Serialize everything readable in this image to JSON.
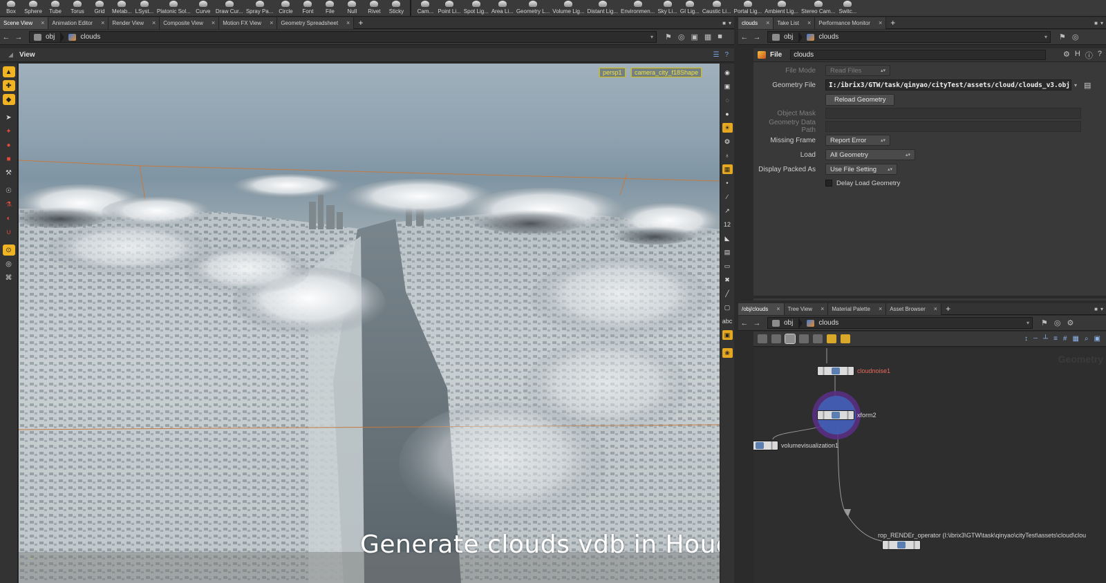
{
  "shelf": {
    "tools_left": [
      {
        "label": "Box",
        "icon": "box-icon"
      },
      {
        "label": "Sphere",
        "icon": "sphere-icon"
      },
      {
        "label": "Tube",
        "icon": "tube-icon"
      },
      {
        "label": "Torus",
        "icon": "torus-icon"
      },
      {
        "label": "Grid",
        "icon": "grid-icon"
      },
      {
        "label": "Metab...",
        "icon": "metaball-icon"
      },
      {
        "label": "LSyst...",
        "icon": "lsystem-icon"
      },
      {
        "label": "Platonic Sol...",
        "icon": "platonic-icon"
      },
      {
        "label": "Curve",
        "icon": "curve-icon"
      },
      {
        "label": "Draw Cur...",
        "icon": "draw-curve-icon"
      },
      {
        "label": "Spray Pa...",
        "icon": "spray-paint-icon"
      },
      {
        "label": "Circle",
        "icon": "circle-icon"
      },
      {
        "label": "Font",
        "icon": "font-icon"
      },
      {
        "label": "File",
        "icon": "file-icon"
      },
      {
        "label": "Null",
        "icon": "null-icon"
      },
      {
        "label": "Rivet",
        "icon": "rivet-icon"
      },
      {
        "label": "Sticky",
        "icon": "sticky-icon"
      }
    ],
    "tools_right": [
      {
        "label": "Cam...",
        "icon": "camera-icon"
      },
      {
        "label": "Point Li...",
        "icon": "point-light-icon"
      },
      {
        "label": "Spot Lig...",
        "icon": "spot-light-icon"
      },
      {
        "label": "Area Li...",
        "icon": "area-light-icon"
      },
      {
        "label": "Geometry L...",
        "icon": "geometry-light-icon"
      },
      {
        "label": "Volume Lig...",
        "icon": "volume-light-icon"
      },
      {
        "label": "Distant Lig...",
        "icon": "distant-light-icon"
      },
      {
        "label": "Environmen...",
        "icon": "environment-light-icon"
      },
      {
        "label": "Sky Li...",
        "icon": "sky-light-icon"
      },
      {
        "label": "GI Lig...",
        "icon": "gi-light-icon"
      },
      {
        "label": "Caustic Li...",
        "icon": "caustic-light-icon"
      },
      {
        "label": "Portal Lig...",
        "icon": "portal-light-icon"
      },
      {
        "label": "Ambient Lig...",
        "icon": "ambient-light-icon"
      },
      {
        "label": "Stereo Cam...",
        "icon": "stereo-camera-icon"
      },
      {
        "label": "Switc...",
        "icon": "switcher-icon"
      }
    ]
  },
  "left_tabs": [
    "Scene View",
    "Animation Editor",
    "Render View",
    "Composite View",
    "Motion FX View",
    "Geometry Spreadsheet"
  ],
  "right_top_tabs": [
    "clouds",
    "Take List",
    "Performance Monitor"
  ],
  "right_bottom_tabs": [
    "/obj/clouds",
    "Tree View",
    "Material Palette",
    "Asset Browser"
  ],
  "path": {
    "root": "obj",
    "node": "clouds"
  },
  "viewer": {
    "title": "View",
    "camera_menu": "persp1",
    "camera_path": "camera_city_f18Shape",
    "caption": "Generate clouds vdb in Houdini"
  },
  "params": {
    "node_type": "File",
    "node_name": "clouds",
    "file_mode_label": "File Mode",
    "file_mode_value": "Read Files",
    "geometry_file_label": "Geometry File",
    "geometry_file_value": "I:/ibrix3/GTW/task/qinyao/cityTest/assets/cloud/clouds_v3.obj",
    "reload_label": "Reload Geometry",
    "object_mask_label": "Object Mask",
    "geo_data_path_label": "Geometry Data Path",
    "missing_frame_label": "Missing Frame",
    "missing_frame_value": "Report Error",
    "load_label": "Load",
    "load_value": "All Geometry",
    "display_packed_label": "Display Packed As",
    "display_packed_value": "Use File Setting",
    "delay_load_label": "Delay Load Geometry"
  },
  "network": {
    "watermark": "Geometry",
    "nodes": {
      "cloudnoise": "cloudnoise1",
      "xform": "xform2",
      "volviz": "volumevisualization1",
      "rop": "rop_RENDEr_operator (I:\\ibrix3\\GTW\\task\\qinyao\\cityTest\\assets\\cloud\\clou"
    }
  },
  "colors": {
    "accent": "#f0b323",
    "selected_node": "#e86a5b",
    "ring": "#7a3fa0"
  }
}
